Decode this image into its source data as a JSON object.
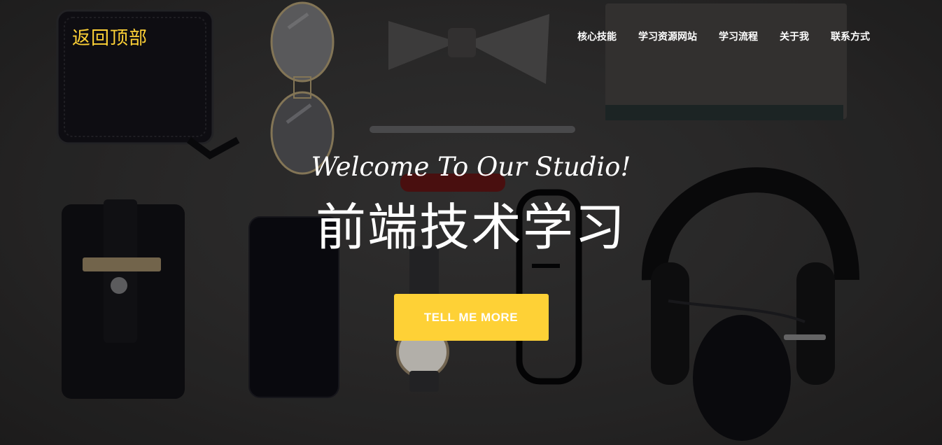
{
  "nav": {
    "brand": "返回顶部",
    "links": [
      "核心技能",
      "学习资源网站",
      "学习流程",
      "关于我",
      "联系方式"
    ]
  },
  "intro": {
    "lead": "Welcome To Our Studio!",
    "heading": "前端技术学习",
    "button": "TELL ME MORE"
  },
  "colors": {
    "accent": "#fed136",
    "text": "#ffffff",
    "background": "#2d2c2c"
  }
}
